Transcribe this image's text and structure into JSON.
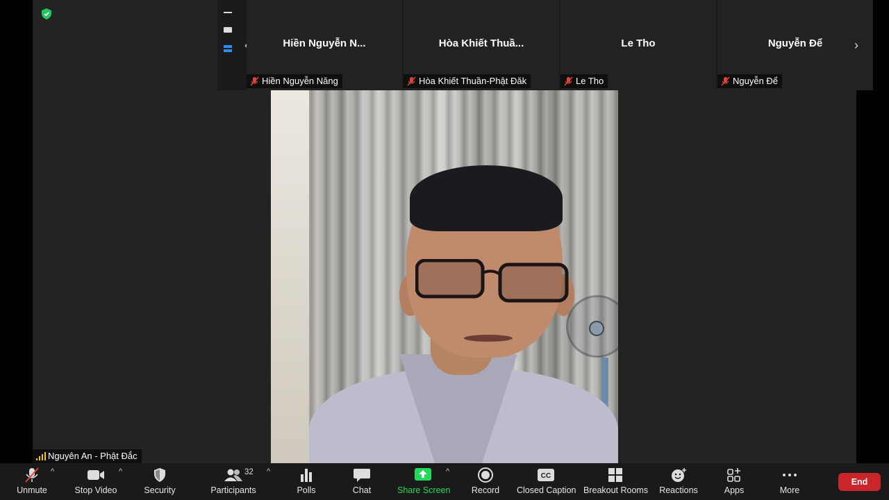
{
  "filmstrip": {
    "tiles": [
      {
        "name": "Hiền Nguyễn N...",
        "label": "Hiền Nguyễn Năng"
      },
      {
        "name": "Hòa Khiết Thuầ...",
        "label": "Hòa Khiết Thuần-Phật Đăk"
      },
      {
        "name": "Le Tho",
        "label": "Le Tho"
      },
      {
        "name": "Nguyễn Để",
        "label": "Nguyễn Để"
      }
    ],
    "prev_arrow": "‹",
    "next_arrow": "›"
  },
  "speaker": {
    "label": "Nguyên An - Phật Đắc"
  },
  "toolbar": {
    "unmute": "Unmute",
    "stop_video": "Stop Video",
    "security": "Security",
    "participants": "Participants",
    "participants_count": "32",
    "polls": "Polls",
    "chat": "Chat",
    "share_screen": "Share Screen",
    "record": "Record",
    "closed_caption": "Closed Caption",
    "breakout_rooms": "Breakout Rooms",
    "reactions": "Reactions",
    "apps": "Apps",
    "more": "More",
    "end": "End",
    "caret": "^"
  },
  "colors": {
    "share_green": "#23d959",
    "end_red": "#c8262a",
    "mic_off_red": "#e0433a",
    "security_green": "#22c55e"
  }
}
